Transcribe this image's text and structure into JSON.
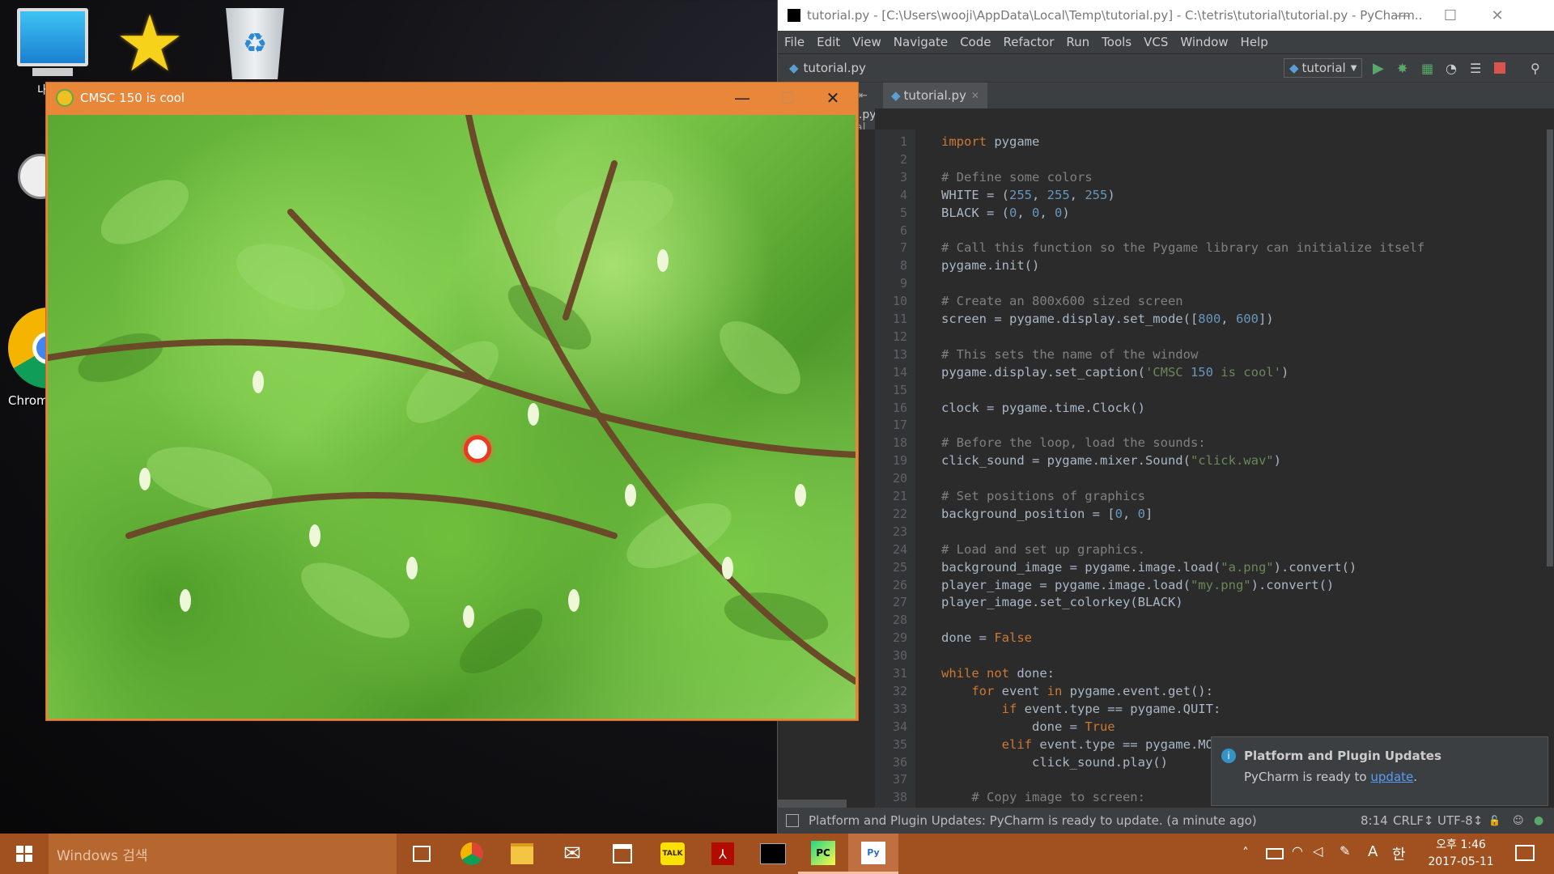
{
  "desktop": {
    "icons": [
      {
        "label": "내 PC"
      },
      {
        "label": "즐겨찾기"
      },
      {
        "label": "휴지통"
      },
      {
        "label": "Chrome"
      }
    ]
  },
  "pycharm": {
    "title": "tutorial.py - [C:\\Users\\wooji\\AppData\\Local\\Temp\\tutorial.py] - C:\\tetris\\tutorial\\tutorial.py - PyCharm...",
    "menu": [
      "File",
      "Edit",
      "View",
      "Navigate",
      "Code",
      "Refactor",
      "Run",
      "Tools",
      "VCS",
      "Window",
      "Help"
    ],
    "breadcrumb": "tutorial.py",
    "run_config": "tutorial",
    "tab_label": "tutorial.py",
    "side_labels": [
      "l.py",
      "al Li"
    ],
    "code_lines": [
      {
        "n": "1",
        "t": "import pygame"
      },
      {
        "n": "2",
        "t": ""
      },
      {
        "n": "3",
        "t": "# Define some colors"
      },
      {
        "n": "4",
        "t": "WHITE = (255, 255, 255)"
      },
      {
        "n": "5",
        "t": "BLACK = (0, 0, 0)"
      },
      {
        "n": "6",
        "t": ""
      },
      {
        "n": "7",
        "t": "# Call this function so the Pygame library can initialize itself"
      },
      {
        "n": "8",
        "t": "pygame.init()"
      },
      {
        "n": "9",
        "t": ""
      },
      {
        "n": "10",
        "t": "# Create an 800x600 sized screen"
      },
      {
        "n": "11",
        "t": "screen = pygame.display.set_mode([800, 600])"
      },
      {
        "n": "12",
        "t": ""
      },
      {
        "n": "13",
        "t": "# This sets the name of the window"
      },
      {
        "n": "14",
        "t": "pygame.display.set_caption('CMSC 150 is cool')"
      },
      {
        "n": "15",
        "t": ""
      },
      {
        "n": "16",
        "t": "clock = pygame.time.Clock()"
      },
      {
        "n": "17",
        "t": ""
      },
      {
        "n": "18",
        "t": "# Before the loop, load the sounds:"
      },
      {
        "n": "19",
        "t": "click_sound = pygame.mixer.Sound(\"click.wav\")"
      },
      {
        "n": "20",
        "t": ""
      },
      {
        "n": "21",
        "t": "# Set positions of graphics"
      },
      {
        "n": "22",
        "t": "background_position = [0, 0]"
      },
      {
        "n": "23",
        "t": ""
      },
      {
        "n": "24",
        "t": "# Load and set up graphics."
      },
      {
        "n": "25",
        "t": "background_image = pygame.image.load(\"a.png\").convert()"
      },
      {
        "n": "26",
        "t": "player_image = pygame.image.load(\"my.png\").convert()"
      },
      {
        "n": "27",
        "t": "player_image.set_colorkey(BLACK)"
      },
      {
        "n": "28",
        "t": ""
      },
      {
        "n": "29",
        "t": "done = False"
      },
      {
        "n": "30",
        "t": ""
      },
      {
        "n": "31",
        "t": "while not done:"
      },
      {
        "n": "32",
        "t": "    for event in pygame.event.get():"
      },
      {
        "n": "33",
        "t": "        if event.type == pygame.QUIT:"
      },
      {
        "n": "34",
        "t": "            done = True"
      },
      {
        "n": "35",
        "t": "        elif event.type == pygame.MOUS"
      },
      {
        "n": "36",
        "t": "            click_sound.play()"
      },
      {
        "n": "37",
        "t": ""
      },
      {
        "n": "38",
        "t": "    # Copy image to screen:"
      }
    ],
    "notification": {
      "title": "Platform and Plugin Updates",
      "body": "PyCharm is ready to ",
      "link": "update",
      "trail": "."
    },
    "status": {
      "message": "Platform and Plugin Updates: PyCharm is ready to update. (a minute ago)",
      "position": "8:14",
      "line_sep": "CRLF↕",
      "encoding": "UTF-8↕"
    }
  },
  "pygame_window": {
    "title": "CMSC 150 is cool"
  },
  "taskbar": {
    "search_placeholder": "Windows 검색",
    "time": "오후 1:46",
    "date": "2017-05-11",
    "ime": "A",
    "lang": "한"
  }
}
